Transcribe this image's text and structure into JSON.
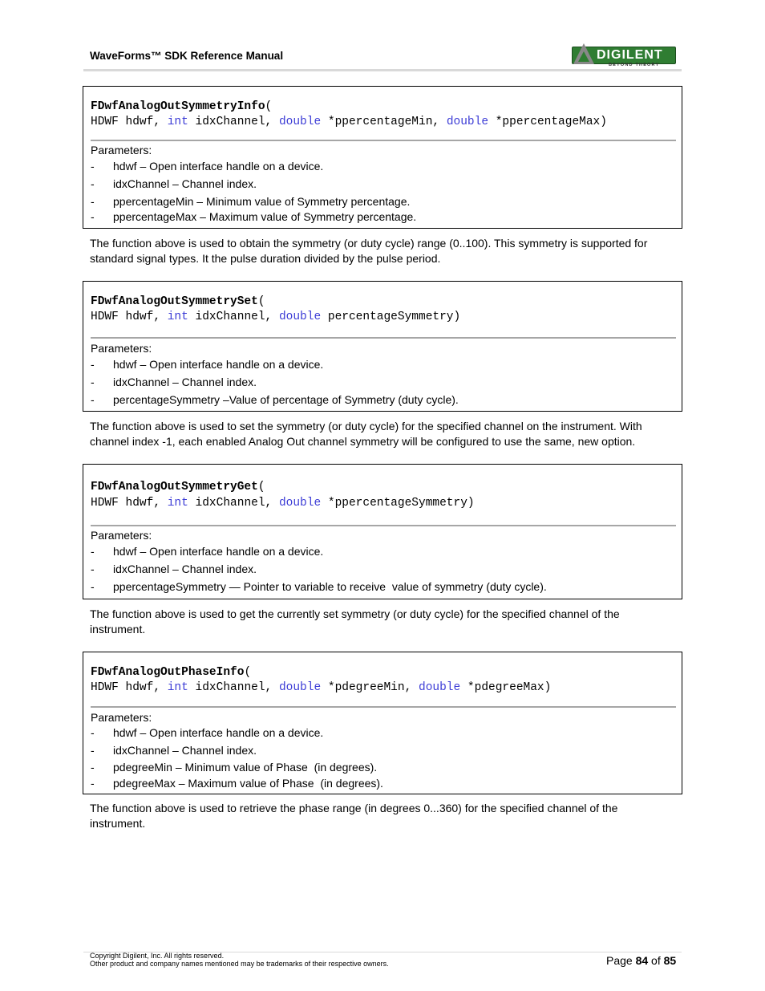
{
  "header": {
    "title": "WaveForms™ SDK Reference Manual",
    "logo": {
      "name": "DIGILENT",
      "tagline": "BEYOND THEORY",
      "color": "#2f7d32"
    }
  },
  "sections": [
    {
      "function": "FDwfAnalogOutSymmetryInfo",
      "open": "(",
      "args": [
        {
          "type": "HDWF",
          "name": "hdwf",
          "kw": false
        },
        {
          "type": "int",
          "name": "idxChannel",
          "kw": true
        },
        {
          "type": "double",
          "name": "*ppercentageMin",
          "kw": true
        },
        {
          "type": "double",
          "name": "*ppercentageMax",
          "kw": true
        }
      ],
      "signature_line2": [
        "HDWF hdwf, ",
        "int",
        " idxChannel, ",
        "double",
        " *ppercentageMin, ",
        "double",
        " *ppercentageMax)"
      ],
      "params_label": "Parameters:",
      "params": [
        "hdwf – Open interface handle on a device.",
        "idxChannel – Channel index.",
        "ppercentageMin – Minimum value of Symmetry percentage.",
        "ppercentageMax – Maximum value of Symmetry percentage."
      ],
      "description": "The function above is used to obtain the symmetry (or duty cycle) range (0..100). This symmetry is supported for standard signal types. It the pulse duration divided by the pulse period."
    },
    {
      "function": "FDwfAnalogOutSymmetrySet",
      "open": "(",
      "signature_line2": [
        "HDWF hdwf, ",
        "int",
        " idxChannel, ",
        "double",
        " percentageSymmetry)"
      ],
      "params_label": "Parameters:",
      "params": [
        "hdwf – Open interface handle on a device.",
        "idxChannel – Channel index.",
        "percentageSymmetry –Value of percentage of Symmetry (duty cycle)."
      ],
      "description": "The function above is used to set the symmetry (or duty cycle) for the specified channel on the instrument. With channel index -1, each enabled Analog Out channel symmetry will be configured to use the same, new option."
    },
    {
      "function": "FDwfAnalogOutSymmetryGet",
      "open": "(",
      "signature_line2": [
        "HDWF hdwf, ",
        "int",
        " idxChannel, ",
        "double",
        " *ppercentageSymmetry)"
      ],
      "params_label": "Parameters:",
      "params": [
        "hdwf – Open interface handle on a device.",
        "idxChannel – Channel index.",
        "ppercentageSymmetry — Pointer to variable to receive  value of symmetry (duty cycle)."
      ],
      "description": "The function above is used to get the currently set symmetry (or duty cycle) for the specified channel of the instrument."
    },
    {
      "function": "FDwfAnalogOutPhaseInfo",
      "open": "(",
      "signature_line2": [
        "HDWF hdwf, ",
        "int",
        " idxChannel, ",
        "double",
        " *pdegreeMin, ",
        "double",
        " *pdegreeMax)"
      ],
      "params_label": "Parameters:",
      "params": [
        "hdwf – Open interface handle on a device.",
        "idxChannel – Channel index.",
        "pdegreeMin – Minimum value of Phase  (in degrees).",
        "pdegreeMax – Maximum value of Phase  (in degrees)."
      ],
      "description": "The function above is used to retrieve the phase range (in degrees 0...360) for the specified channel of the instrument."
    }
  ],
  "footer": {
    "copyright": "Copyright Digilent, Inc. All rights reserved.",
    "trademark": "Other product and company names mentioned may be trademarks of their respective owners.",
    "page_prefix": "Page ",
    "page_current": "84",
    "page_of": " of ",
    "page_total": "85"
  }
}
